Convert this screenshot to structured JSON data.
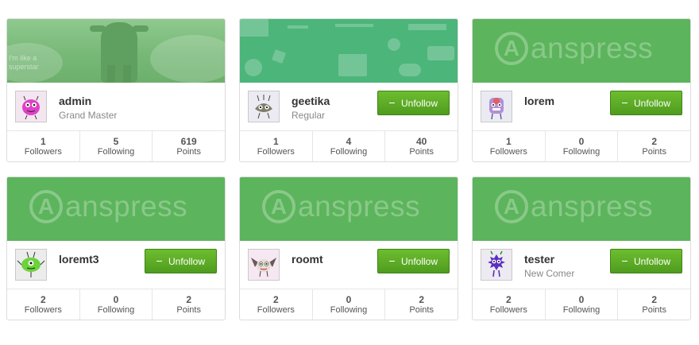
{
  "colors": {
    "cover_green": "#5cb45c",
    "button_green": "#5aa925",
    "pattern_green": "#4cb57a"
  },
  "logo_text": "anspress",
  "logo_letter": "A",
  "admin_cover_text": "I'm like a superstar",
  "button_label": "Unfollow",
  "stat_labels": {
    "followers": "Followers",
    "following": "Following",
    "points": "Points"
  },
  "users": [
    {
      "name": "admin",
      "role": "Grand Master",
      "cover": "photo",
      "avatar_icon": "pink-monster-icon",
      "followers": "1",
      "following": "5",
      "points": "619",
      "show_unfollow": false
    },
    {
      "name": "geetika",
      "role": "Regular",
      "cover": "pattern",
      "avatar_icon": "gray-monster-icon",
      "followers": "1",
      "following": "4",
      "points": "40",
      "show_unfollow": true
    },
    {
      "name": "lorem",
      "role": "",
      "cover": "anspress",
      "avatar_icon": "purple-monster-icon",
      "followers": "1",
      "following": "0",
      "points": "2",
      "show_unfollow": true
    },
    {
      "name": "loremt3",
      "role": "",
      "cover": "anspress",
      "avatar_icon": "green-monster-icon",
      "followers": "2",
      "following": "0",
      "points": "2",
      "show_unfollow": true
    },
    {
      "name": "roomt",
      "role": "",
      "cover": "anspress",
      "avatar_icon": "winged-monster-icon",
      "followers": "2",
      "following": "0",
      "points": "2",
      "show_unfollow": true
    },
    {
      "name": "tester",
      "role": "New Comer",
      "cover": "anspress",
      "avatar_icon": "blue-monster-icon",
      "followers": "2",
      "following": "0",
      "points": "2",
      "show_unfollow": true
    }
  ]
}
